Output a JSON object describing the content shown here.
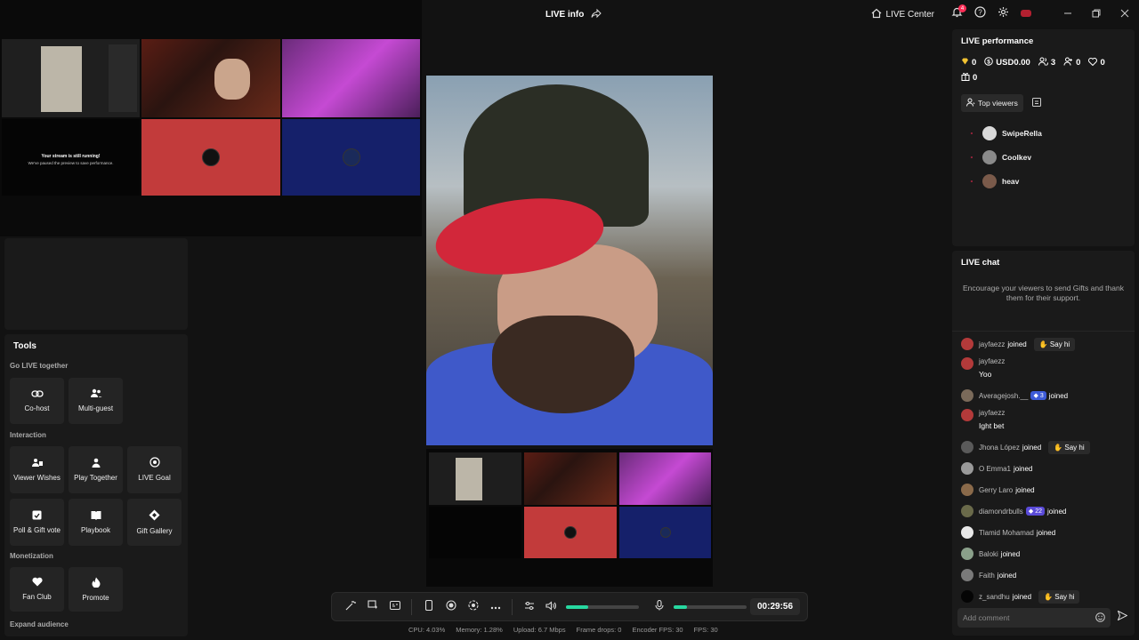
{
  "header": {
    "title": "LIVE info",
    "live_center": "LIVE Center",
    "notif_count": "4"
  },
  "preview": {
    "msg_title": "Your stream is still running!",
    "msg_body": "We've paused the preview to save performance."
  },
  "tools": {
    "title": "Tools",
    "sections": {
      "go_live": "Go LIVE together",
      "interaction": "Interaction",
      "monetization": "Monetization",
      "expand": "Expand audience"
    },
    "cohost": "Co-host",
    "multiguest": "Multi-guest",
    "viewer_wishes": "Viewer Wishes",
    "play_together": "Play Together",
    "live_goal": "LIVE Goal",
    "poll": "Poll & Gift vote",
    "playbook": "Playbook",
    "gift_gallery": "Gift Gallery",
    "fan_club": "Fan Club",
    "promote": "Promote"
  },
  "controls": {
    "timer": "00:29:56",
    "volume_level": 0.3,
    "mic_level": 0.18
  },
  "stats": {
    "cpu": "CPU: 4.03%",
    "memory": "Memory: 1.28%",
    "upload": "Upload: 6.7 Mbps",
    "frame_drops": "Frame drops: 0",
    "encoder_fps": "Encoder FPS: 30",
    "fps": "FPS: 30"
  },
  "performance": {
    "title": "LIVE performance",
    "diamonds": "0",
    "usd": "USD0.00",
    "viewers": "3",
    "followers": "0",
    "likes": "0",
    "gifts": "0",
    "tab_top_viewers": "Top viewers",
    "top_viewers": [
      {
        "rank": "-",
        "name": "SwipeRella",
        "color": "#d9d9d9"
      },
      {
        "rank": "-",
        "name": "Coolkev",
        "color": "#8a8a8a"
      },
      {
        "rank": "-",
        "name": "heav",
        "color": "#7a5a4a"
      }
    ]
  },
  "chat": {
    "title": "LIVE chat",
    "encourage": "Encourage your viewers to send Gifts and thank them for their support.",
    "say_hi": "Say hi",
    "joined": "joined",
    "add_comment": "Add comment",
    "items": [
      {
        "user": "jayfaezz",
        "type": "join",
        "sayhi": true,
        "color": "#b33a3a"
      },
      {
        "user": "jayfaezz",
        "type": "msg",
        "text": "Yoo",
        "color": "#b33a3a"
      },
      {
        "user": "Averagejosh.__",
        "type": "join",
        "badge": "3",
        "badge_color": "#3d5bd8",
        "color": "#7a6a5a"
      },
      {
        "user": "jayfaezz",
        "type": "msg",
        "text": "Ight bet",
        "color": "#b33a3a"
      },
      {
        "user": "Jhona López",
        "type": "join",
        "sayhi": true,
        "color": "#5a5a5a"
      },
      {
        "user": "O Emma1",
        "type": "join",
        "color": "#9a9a9a"
      },
      {
        "user": "Gerry Laro",
        "type": "join",
        "color": "#8a6a4a"
      },
      {
        "user": "diamondrbulls",
        "type": "join",
        "badge": "22",
        "badge_color": "#5a4bd8",
        "color": "#6a6a4a"
      },
      {
        "user": "Tlamid Mohamad",
        "type": "join",
        "color": "#e8e8e8"
      },
      {
        "user": "Baloki",
        "type": "join",
        "color": "#8aa08a"
      },
      {
        "user": "Faith",
        "type": "join",
        "color": "#7a7a7a"
      },
      {
        "user": "z_sandhu",
        "type": "join",
        "sayhi": true,
        "color": "#050505"
      }
    ]
  }
}
